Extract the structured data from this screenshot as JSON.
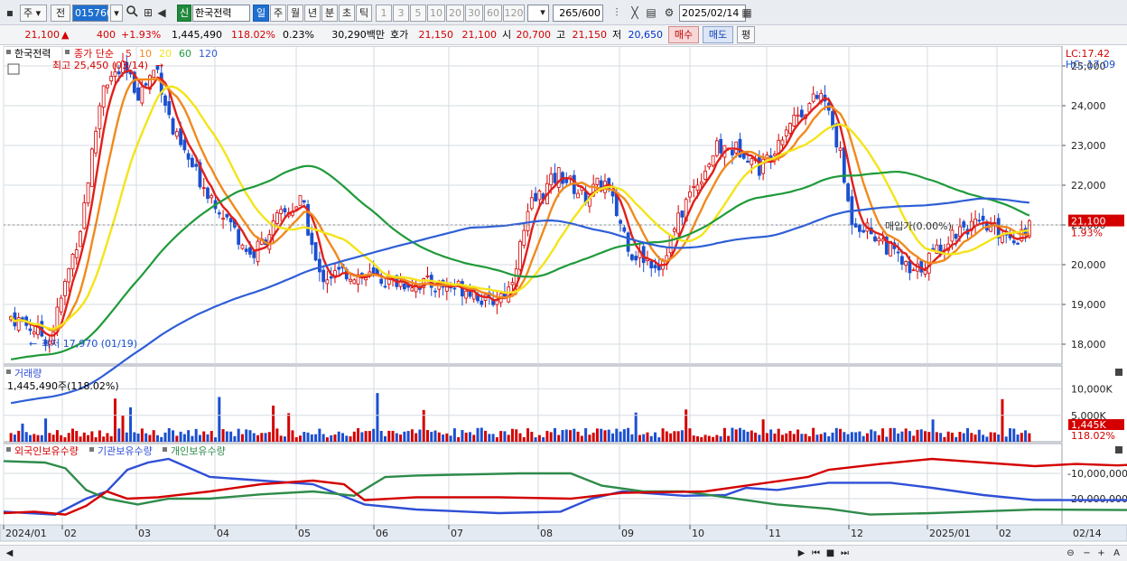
{
  "toolbar": {
    "market": "주",
    "market_mode": "전",
    "code": "015760",
    "badge": "신",
    "name": "한국전력",
    "periods": [
      "일",
      "주",
      "월",
      "년",
      "분",
      "초",
      "틱"
    ],
    "active_period": "일",
    "counts": [
      "1",
      "3",
      "5",
      "10",
      "20",
      "30",
      "60",
      "120"
    ],
    "count_value": "265",
    "count_max": "/600",
    "date": "2025/02/14"
  },
  "quote": {
    "price": "21,100",
    "change": "400",
    "change_pct": "+1.93%",
    "volume": "1,445,490",
    "volume_ratio": "118.02%",
    "turnover": "0.23%",
    "amount": "30,290백만",
    "bid_ask_label": "호가",
    "ask": "21,150",
    "bid": "21,100",
    "open_label": "시",
    "open": "20,700",
    "high_label": "고",
    "high": "21,150",
    "low_label": "저",
    "low": "20,650",
    "buy_label": "매수",
    "sell_label": "매도",
    "eval_label": "평"
  },
  "price_panel": {
    "stock_name": "한국전력",
    "ma_label": "종가 단순",
    "ma_periods": [
      {
        "label": "5",
        "color": "#e0201b"
      },
      {
        "label": "10",
        "color": "#f08a1e"
      },
      {
        "label": "20",
        "color": "#f4e41a"
      },
      {
        "label": "60",
        "color": "#1f9a3a"
      },
      {
        "label": "120",
        "color": "#2f5fd6"
      }
    ],
    "high_note": "최고 25,450 (03/14)",
    "low_note": "최저 17,970 (01/19)",
    "lc": "LC:17.42",
    "hc": "HC:-17.09",
    "y_ticks": [
      "25,000",
      "24,000",
      "23,000",
      "22,000",
      "21,000",
      "20,000",
      "19,000",
      "18,000"
    ],
    "current_price": "21,100",
    "current_pct": "1.93%",
    "avg_note": "매입가(0.00%)"
  },
  "volume_panel": {
    "title": "거래량",
    "value": "1,445,490주(118.02%)",
    "y_ticks": [
      "10,000K",
      "5,000K"
    ],
    "current": "1,445K",
    "current_pct": "118.02%"
  },
  "holding_panel": {
    "legend": [
      {
        "label": "외국인보유수량",
        "color": "#d40000"
      },
      {
        "label": "기관보유수량",
        "color": "#2f4fd6"
      },
      {
        "label": "개인보유수량",
        "color": "#2e8b4a"
      }
    ],
    "y_ticks": [
      "-10,000,000",
      "-20,000,000"
    ]
  },
  "x_axis": {
    "labels": [
      "2024/01",
      "02",
      "03",
      "04",
      "05",
      "06",
      "07",
      "08",
      "09",
      "10",
      "11",
      "12",
      "2025/01",
      "02"
    ],
    "end_label": "02/14"
  },
  "colors": {
    "up": "#d40000",
    "down": "#1a4fd0",
    "accent": "#1f6fcf"
  }
}
